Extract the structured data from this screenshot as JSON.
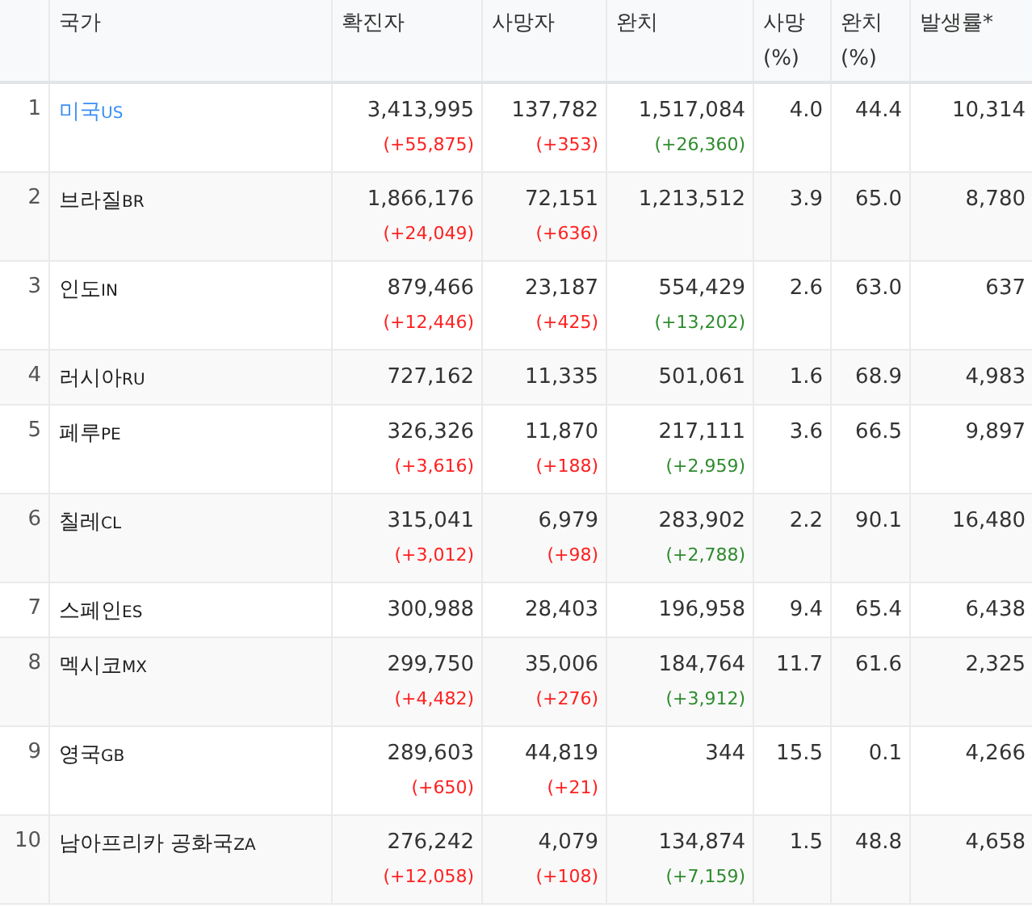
{
  "table": {
    "columns": [
      "국가",
      "확진자",
      "사망자",
      "완치",
      "사망 (%)",
      "완치 (%)",
      "발생률*"
    ],
    "rows": [
      {
        "rank": "1",
        "country": "미국",
        "code": "US",
        "linked": true,
        "confirmed": "3,413,995",
        "confirmed_delta": "(+55,875)",
        "deaths": "137,782",
        "deaths_delta": "(+353)",
        "recovered": "1,517,084",
        "recovered_delta": "(+26,360)",
        "death_rate": "4.0",
        "recovery_rate": "44.4",
        "incidence": "10,314"
      },
      {
        "rank": "2",
        "country": "브라질",
        "code": "BR",
        "linked": false,
        "confirmed": "1,866,176",
        "confirmed_delta": "(+24,049)",
        "deaths": "72,151",
        "deaths_delta": "(+636)",
        "recovered": "1,213,512",
        "death_rate": "3.9",
        "recovery_rate": "65.0",
        "incidence": "8,780"
      },
      {
        "rank": "3",
        "country": "인도",
        "code": "IN",
        "linked": false,
        "confirmed": "879,466",
        "confirmed_delta": "(+12,446)",
        "deaths": "23,187",
        "deaths_delta": "(+425)",
        "recovered": "554,429",
        "recovered_delta": "(+13,202)",
        "death_rate": "2.6",
        "recovery_rate": "63.0",
        "incidence": "637"
      },
      {
        "rank": "4",
        "country": "러시아",
        "code": "RU",
        "linked": false,
        "confirmed": "727,162",
        "deaths": "11,335",
        "recovered": "501,061",
        "death_rate": "1.6",
        "recovery_rate": "68.9",
        "incidence": "4,983"
      },
      {
        "rank": "5",
        "country": "페루",
        "code": "PE",
        "linked": false,
        "confirmed": "326,326",
        "confirmed_delta": "(+3,616)",
        "deaths": "11,870",
        "deaths_delta": "(+188)",
        "recovered": "217,111",
        "recovered_delta": "(+2,959)",
        "death_rate": "3.6",
        "recovery_rate": "66.5",
        "incidence": "9,897"
      },
      {
        "rank": "6",
        "country": "칠레",
        "code": "CL",
        "linked": false,
        "confirmed": "315,041",
        "confirmed_delta": "(+3,012)",
        "deaths": "6,979",
        "deaths_delta": "(+98)",
        "recovered": "283,902",
        "recovered_delta": "(+2,788)",
        "death_rate": "2.2",
        "recovery_rate": "90.1",
        "incidence": "16,480"
      },
      {
        "rank": "7",
        "country": "스페인",
        "code": "ES",
        "linked": false,
        "confirmed": "300,988",
        "deaths": "28,403",
        "recovered": "196,958",
        "death_rate": "9.4",
        "recovery_rate": "65.4",
        "incidence": "6,438"
      },
      {
        "rank": "8",
        "country": "멕시코",
        "code": "MX",
        "linked": false,
        "confirmed": "299,750",
        "confirmed_delta": "(+4,482)",
        "deaths": "35,006",
        "deaths_delta": "(+276)",
        "recovered": "184,764",
        "recovered_delta": "(+3,912)",
        "death_rate": "11.7",
        "recovery_rate": "61.6",
        "incidence": "2,325"
      },
      {
        "rank": "9",
        "country": "영국",
        "code": "GB",
        "linked": false,
        "confirmed": "289,603",
        "confirmed_delta": "(+650)",
        "deaths": "44,819",
        "deaths_delta": "(+21)",
        "recovered": "344",
        "death_rate": "15.5",
        "recovery_rate": "0.1",
        "incidence": "4,266"
      },
      {
        "rank": "10",
        "country": "남아프리카 공화국",
        "code": "ZA",
        "linked": false,
        "confirmed": "276,242",
        "confirmed_delta": "(+12,058)",
        "deaths": "4,079",
        "deaths_delta": "(+108)",
        "recovered": "134,874",
        "recovered_delta": "(+7,159)",
        "death_rate": "1.5",
        "recovery_rate": "48.8",
        "incidence": "4,658"
      }
    ]
  }
}
